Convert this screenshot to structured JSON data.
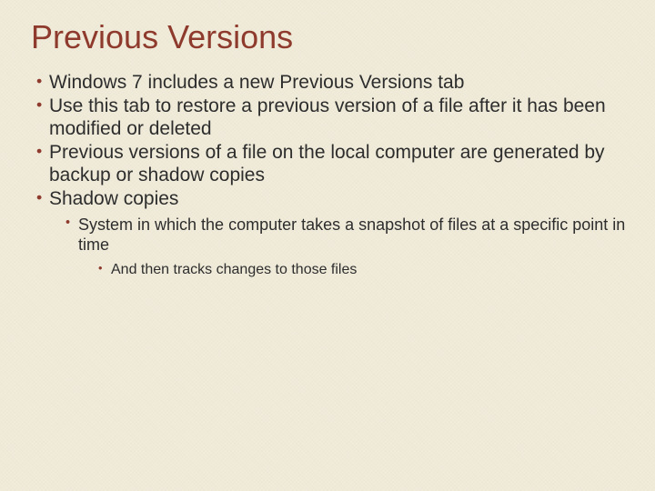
{
  "title": "Previous Versions",
  "bullets": {
    "b1": "Windows 7 includes a new Previous Versions tab",
    "b2": "Use this tab to restore a previous version of a file after it has been modified or deleted",
    "b3": "Previous versions of a file on the local computer are generated by backup or shadow copies",
    "b4": "Shadow copies",
    "b4_1": "System in which the computer takes a snapshot of files at a specific point in time",
    "b4_1_1": "And then tracks changes to those files"
  }
}
